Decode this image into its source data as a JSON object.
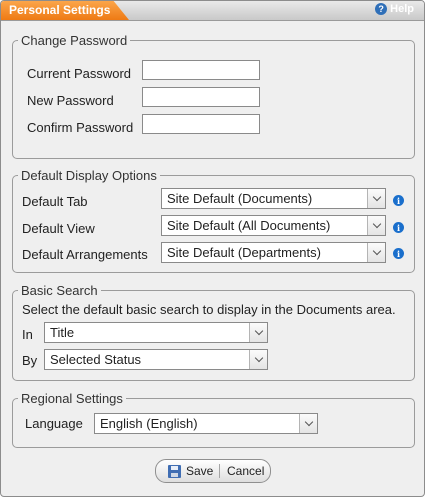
{
  "window": {
    "title": "Personal Settings",
    "help_label": "Help",
    "help_icon": "question-circle-icon"
  },
  "change_password": {
    "legend": "Change Password",
    "current_label": "Current Password",
    "current_value": "",
    "new_label": "New Password",
    "new_value": "",
    "confirm_label": "Confirm Password",
    "confirm_value": ""
  },
  "display_options": {
    "legend": "Default Display Options",
    "tab_label": "Default Tab",
    "tab_value": "Site Default (Documents)",
    "view_label": "Default View",
    "view_value": "Site Default (All Documents)",
    "arrangements_label": "Default Arrangements",
    "arrangements_value": "Site Default (Departments)",
    "info_icon": "info-icon"
  },
  "basic_search": {
    "legend": "Basic Search",
    "description": "Select the default basic search to display in the Documents area.",
    "in_label": "In",
    "in_value": "Title",
    "by_label": "By",
    "by_value": "Selected Status"
  },
  "regional": {
    "legend": "Regional Settings",
    "language_label": "Language",
    "language_value": "English (English)"
  },
  "buttons": {
    "save_label": "Save",
    "cancel_label": "Cancel"
  },
  "colors": {
    "title_tab": "#ee7a14",
    "accent_blue": "#1a6fcc",
    "panel_bg": "#efefef"
  }
}
